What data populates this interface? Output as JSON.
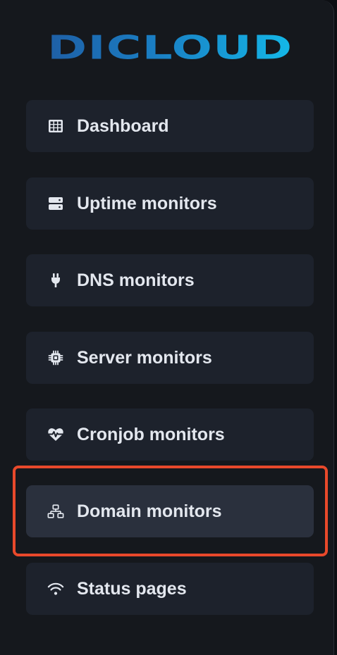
{
  "logo": {
    "text": "DICLOUD"
  },
  "nav": {
    "items": [
      {
        "label": "Dashboard",
        "icon": "table-icon"
      },
      {
        "label": "Uptime monitors",
        "icon": "server-icon"
      },
      {
        "label": "DNS monitors",
        "icon": "plug-icon"
      },
      {
        "label": "Server monitors",
        "icon": "cpu-chip-icon"
      },
      {
        "label": "Cronjob monitors",
        "icon": "heart-pulse-icon"
      },
      {
        "label": "Domain monitors",
        "icon": "network-icon",
        "active": true
      },
      {
        "label": "Status pages",
        "icon": "wifi-icon"
      }
    ]
  },
  "colors": {
    "background": "#15181d",
    "item_background": "#1d222c",
    "active_item_background": "#2a303d",
    "text": "#e3e7ee",
    "highlight": "#e8492b",
    "logo_gradient_start": "#1e5fa6",
    "logo_gradient_end": "#14b8e8"
  }
}
